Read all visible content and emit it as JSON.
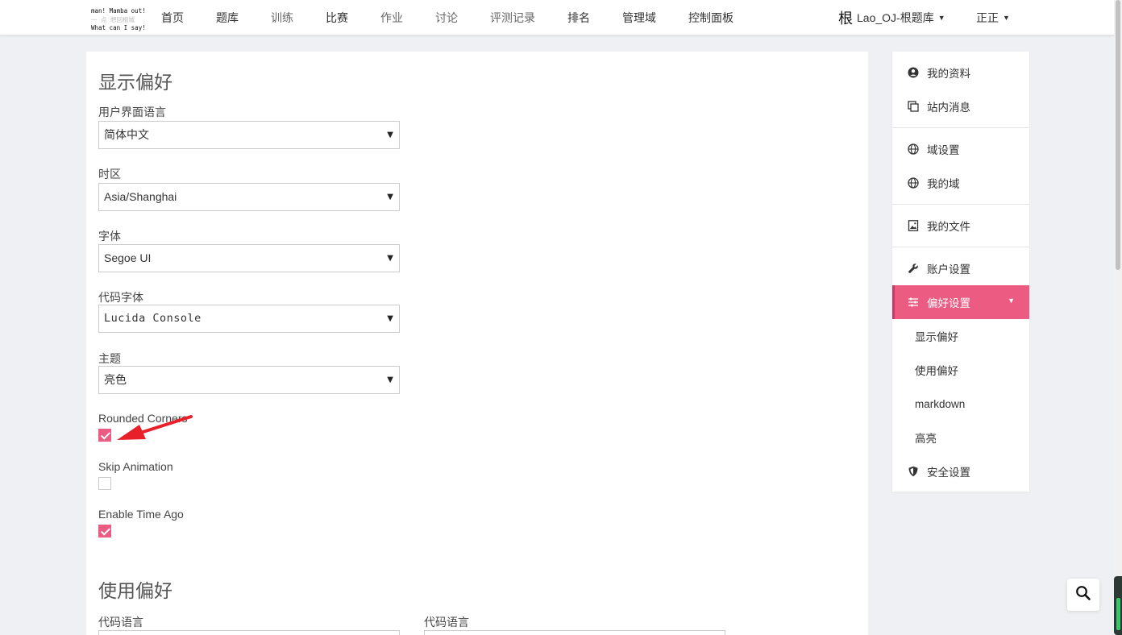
{
  "nav": {
    "logo": {
      "line1": "man! Mamba out!",
      "line2": "一 点 想回根城",
      "line3": "What can I say!"
    },
    "items": [
      "首页",
      "题库",
      "训练",
      "比赛",
      "作业",
      "讨论",
      "评测记录",
      "排名",
      "管理域",
      "控制面板"
    ],
    "domain": {
      "glyph": "根",
      "label": "Lao_OJ-根题库"
    },
    "user": "正正"
  },
  "display_prefs": {
    "title": "显示偏好",
    "ui_language": {
      "label": "用户界面语言",
      "value": "简体中文"
    },
    "timezone": {
      "label": "时区",
      "value": "Asia/Shanghai"
    },
    "font": {
      "label": "字体",
      "value": "Segoe UI"
    },
    "code_font": {
      "label": "代码字体",
      "value": "Lucida Console"
    },
    "theme": {
      "label": "主题",
      "value": "亮色"
    },
    "rounded_corners": {
      "label": "Rounded Corners",
      "checked": true
    },
    "skip_animation": {
      "label": "Skip Animation",
      "checked": false
    },
    "enable_time_ago": {
      "label": "Enable Time Ago",
      "checked": true
    }
  },
  "usage_prefs": {
    "title": "使用偏好",
    "code_lang_1": {
      "label": "代码语言"
    },
    "code_lang_2": {
      "label": "代码语言"
    }
  },
  "sidebar": {
    "profile": "我的资料",
    "messages": "站内消息",
    "domain_settings": "域设置",
    "my_domains": "我的域",
    "my_files": "我的文件",
    "account_settings": "账户设置",
    "preferences": "偏好设置",
    "sub": {
      "display": "显示偏好",
      "usage": "使用偏好",
      "markdown": "markdown",
      "highlight": "高亮"
    },
    "security": "安全设置"
  },
  "colors": {
    "accent": "#ec5b82",
    "annotation_arrow": "#e8202a"
  }
}
